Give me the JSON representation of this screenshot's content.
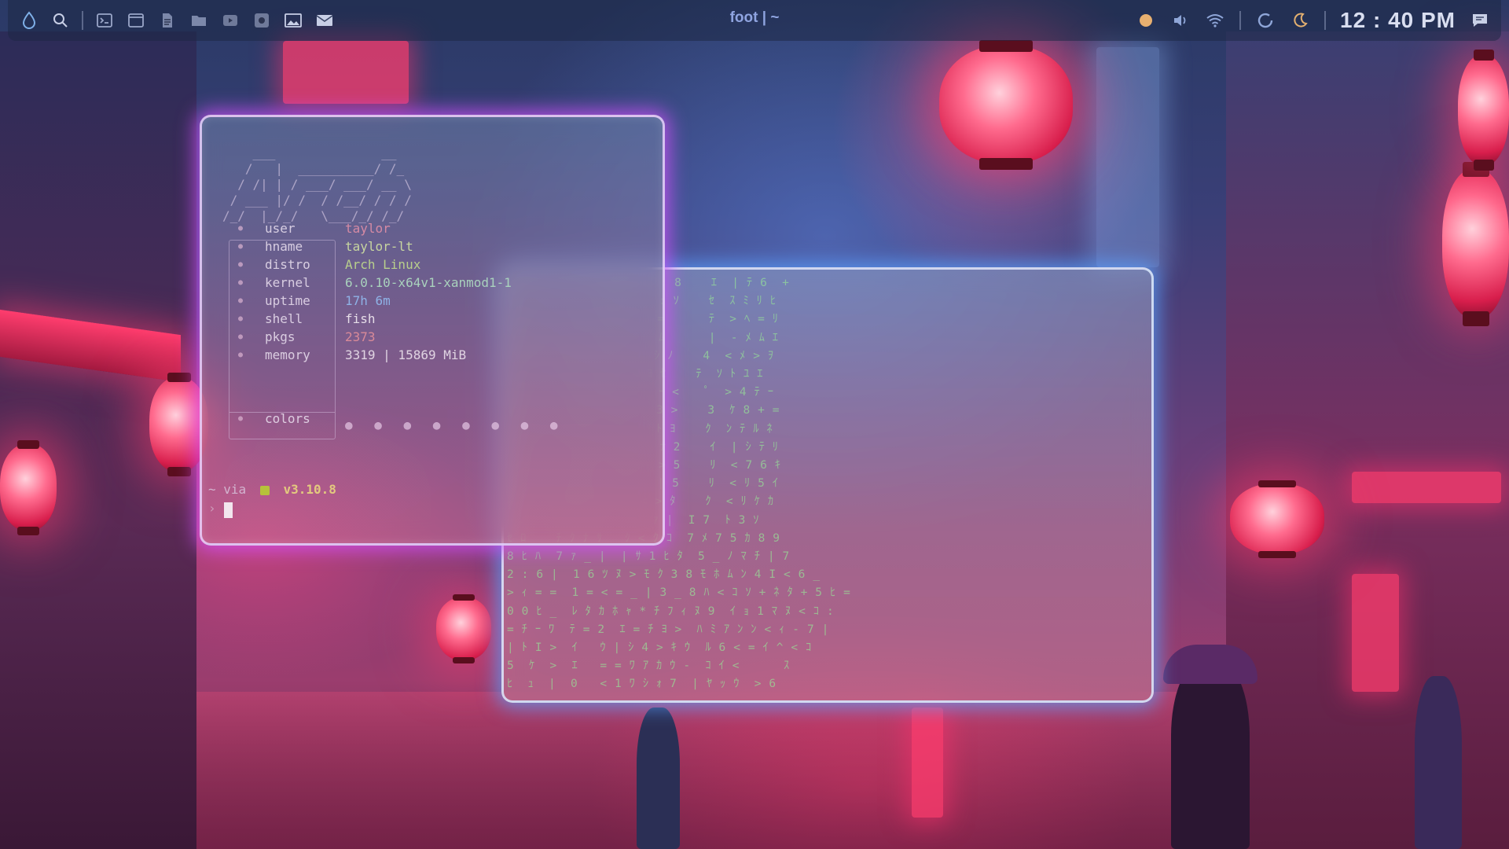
{
  "topbar": {
    "window_title": "foot | ~",
    "clock": "12 : 40 PM",
    "left_icons": [
      "droplet-icon",
      "search-icon",
      "terminal-icon",
      "window-icon",
      "document-icon",
      "folder-icon",
      "video-icon",
      "screenshot-icon",
      "image-icon",
      "mail-icon"
    ],
    "right_icons": [
      "status-dot-icon",
      "volume-icon",
      "wifi-icon",
      "refresh-icon",
      "moon-icon",
      "notification-icon"
    ]
  },
  "fetch": {
    "ascii_logo": "    ___              __\n   /   |  __________/ /_\n  / /| | / ___/ ___/ __ \\\n / ___ |/ /  / /__/ / / /\n/_/  |_/_/   \\___/_/ /_/",
    "rows": [
      {
        "key": "user",
        "value": "taylor",
        "color": "#d58aa4"
      },
      {
        "key": "hname",
        "value": "taylor-lt",
        "color": "#c7d6a0"
      },
      {
        "key": "distro",
        "value": "Arch Linux",
        "color": "#b8cf8c"
      },
      {
        "key": "kernel",
        "value": "6.0.10-x64v1-xanmod1-1",
        "color": "#a9d2bd"
      },
      {
        "key": "uptime",
        "value": "17h 6m",
        "color": "#8fb2e6"
      },
      {
        "key": "shell",
        "value": "fish",
        "color": "#e6dde8"
      },
      {
        "key": "pkgs",
        "value": "2373",
        "color": "#d98a98"
      },
      {
        "key": "memory",
        "value": "3319 | 15869 MiB",
        "color": "#e0d4e2"
      }
    ],
    "colors_key": "colors",
    "colors_dots": "● ● ● ● ● ● ● ●",
    "prompt_dir": "~",
    "prompt_via": "via",
    "prompt_version": "v3.10.8",
    "prompt_symbol": "›"
  },
  "matrix": {
    "text": "9  <         * ﾀ     : 8    ｴ  | ﾃ 6  +\nｱ  ｸ         1 4     : ｿ    ｾ  ｽ ﾐ ﾘ ﾋ\nﾂ 1 ｿ    >   ｼ =     =      ﾃ  > ﾍ = ﾘ\n1 1 :    1   ﾈ ｧ     ﾑ      |  - ﾒ ﾑ ｴ\nｺ ﾊ ﾊ    ﾑ   ｴ ﾁ     ｼ ﾉ    4  < ﾒ > ｦ\n|  ﾟ     ｶ   ﾞ ｯ     ﾖ ｾ    ﾃ  ｿ ﾄ ﾕ ｴ\n7 |      ﾓ + 0 ﾆ     ｰ <    ﾟ  > 4 ﾃ ｰ\nﾅ +      ﾗ ｴ   ﾚ     3 >    3  ｹ 8 + =\nﾅ +      ｷ ﾃ   ﾚ _   ﾄ ﾖ    ｸ  ﾝ ﾃ ﾙ ﾈ\n= :        ﾗ   < >   ﾅ 2    ｲ  | ｼ ﾃ ﾘ\nｱ ｿ    _ < <   * *   > 5    ﾘ  < 7 6 ｷ\nｽ ﾏ    _ < ｸ   * *   | 5    ﾘ  < ﾘ 5 ｲ\nﾏ ﾅ    ｳ 9 ﾃ 0   ｾ < > ﾀ    ｸ  < ﾘ ｹ ｶ\nﾊ ﾕ    6 ｽ ｸ ﾑ   ｸ ｸ ｧ |  I 7  ﾄ 3 ｿ\nｾ ﾛ    ﾁ ｸ ﾅ ｻ   ｸ < ｸ ｺ  7 ﾒ 7 5 ｶ 8 9\n8 ﾋ ﾊ  7 ｧ _ |  | ｻ 1 ﾋ ﾀ  5 _ ﾉ ﾏ ﾁ | 7\n2 : 6 |  1 6 ﾂ ﾇ > ﾓ ｸ 3 8 ﾓ ﾎ ﾑ ﾝ 4 I < 6 _\n> ｨ = =  1 = < = _ | 3 _ 8 ﾊ < ｺ ｿ + ﾈ ﾀ + 5 ﾋ =\n0 0 ﾋ _  ﾚ ﾀ ｶ ﾎ ｬ * ﾁ ﾌ ｨ ﾇ 9  ｲ ｮ 1 ﾏ ﾇ < ｺ :\n= ﾁ ｰ ﾜ  ﾃ = 2  ｴ = ﾁ ﾖ >  ﾊ ﾐ ｱ ﾝ ﾝ < ｨ - 7 |\n| ﾄ I >  ｲ   ｳ | ｼ 4 > ｷ ｳ  ﾙ 6 < = ｲ ^ < ｺ\n5  ｹ  >  ｴ   = = ﾜ ｱ ｶ ｳ -  ｺ ｲ <      ｽ\nﾋ  ｭ  |  0   < 1 ﾜ ｼ ｫ 7  | ﾔ ｯ ｳ  > 6"
  }
}
